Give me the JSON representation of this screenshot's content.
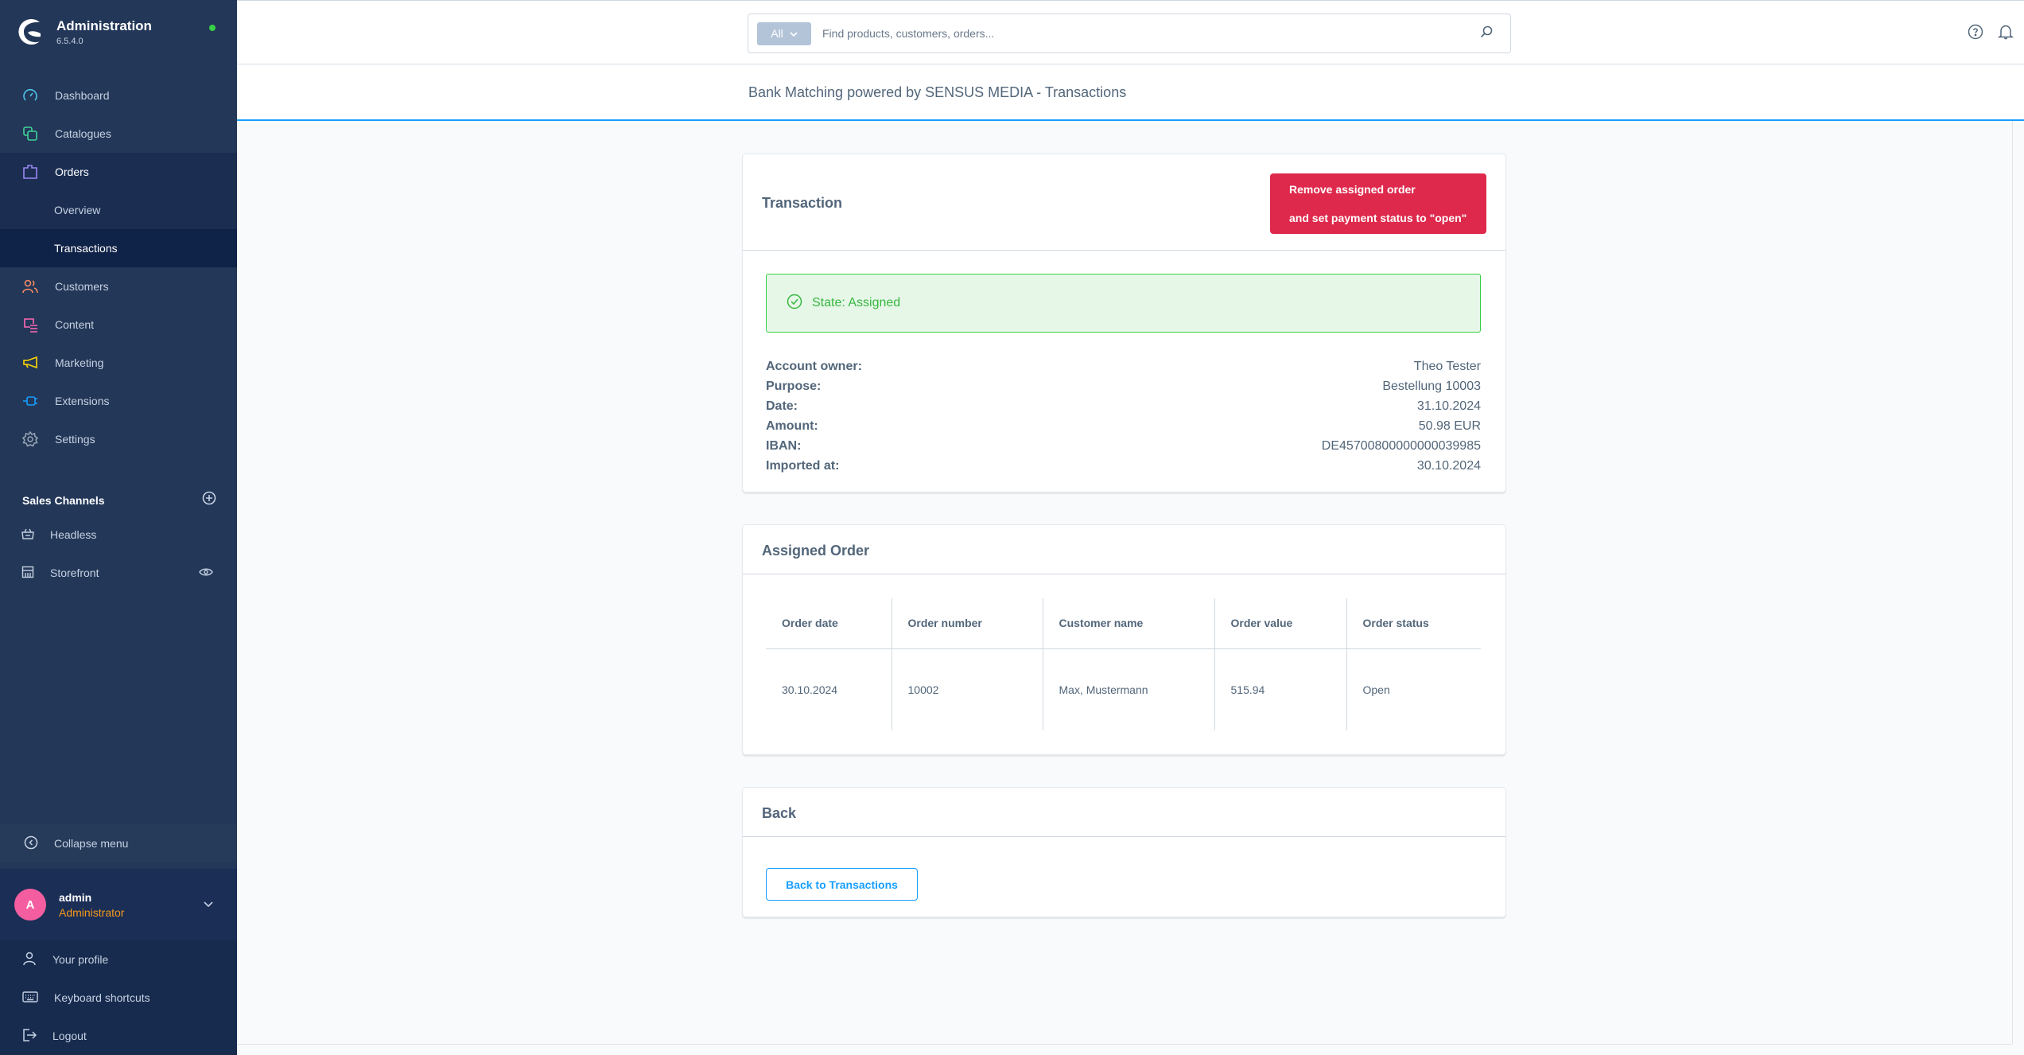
{
  "app": {
    "title": "Administration",
    "version": "6.5.4.0",
    "status_color": "#37d046"
  },
  "sidebar": {
    "nav": [
      {
        "label": "Dashboard",
        "icon": "dashboard-icon",
        "color": "#4dc4e8"
      },
      {
        "label": "Catalogues",
        "icon": "catalogues-icon",
        "color": "#40d39a"
      },
      {
        "label": "Orders",
        "icon": "orders-icon",
        "color": "#9b87f5",
        "active": true
      },
      {
        "label": "Customers",
        "icon": "customers-icon",
        "color": "#f88962"
      },
      {
        "label": "Content",
        "icon": "content-icon",
        "color": "#ff68b4"
      },
      {
        "label": "Marketing",
        "icon": "marketing-icon",
        "color": "#ffd700"
      },
      {
        "label": "Extensions",
        "icon": "extensions-icon",
        "color": "#189eff"
      },
      {
        "label": "Settings",
        "icon": "settings-icon",
        "color": "#9aa8b5"
      }
    ],
    "orders_sub": [
      {
        "label": "Overview"
      },
      {
        "label": "Transactions",
        "current": true
      }
    ],
    "sales_channels": {
      "title": "Sales Channels",
      "items": [
        {
          "label": "Headless",
          "icon": "basket-icon"
        },
        {
          "label": "Storefront",
          "icon": "storefront-icon"
        }
      ]
    },
    "collapse_label": "Collapse menu",
    "user": {
      "initial": "A",
      "name": "admin",
      "role": "Administrator"
    },
    "user_menu": [
      {
        "label": "Your profile",
        "icon": "profile-icon"
      },
      {
        "label": "Keyboard shortcuts",
        "icon": "keyboard-icon"
      },
      {
        "label": "Logout",
        "icon": "logout-icon"
      }
    ]
  },
  "topbar": {
    "search_type": "All",
    "search_placeholder": "Find products, customers, orders..."
  },
  "page": {
    "title": "Bank Matching powered by SENSUS MEDIA - Transactions"
  },
  "transaction_card": {
    "title": "Transaction",
    "remove_button_line1": "Remove assigned order",
    "remove_button_line2": "and set payment status to \"open\"",
    "state": "State: Assigned",
    "fields": [
      {
        "label": "Account owner:",
        "value": "Theo Tester"
      },
      {
        "label": "Purpose:",
        "value": "Bestellung 10003"
      },
      {
        "label": "Date:",
        "value": "31.10.2024"
      },
      {
        "label": "Amount:",
        "value": "50.98 EUR"
      },
      {
        "label": "IBAN:",
        "value": "DE45700800000000039985"
      },
      {
        "label": "Imported at:",
        "value": "30.10.2024"
      }
    ]
  },
  "assigned_order_card": {
    "title": "Assigned Order",
    "columns": [
      "Order date",
      "Order number",
      "Customer name",
      "Order value",
      "Order status"
    ],
    "rows": [
      [
        "30.10.2024",
        "10002",
        "Max, Mustermann",
        "515.94",
        "Open"
      ]
    ]
  },
  "back_card": {
    "title": "Back",
    "button_label": "Back to Transactions"
  },
  "colors": {
    "sidebar_bg": "#233758",
    "accent": "#189eff",
    "danger": "#de294c",
    "success": "#37d046",
    "role": "#f69a1a",
    "avatar": "#f45ea0"
  }
}
